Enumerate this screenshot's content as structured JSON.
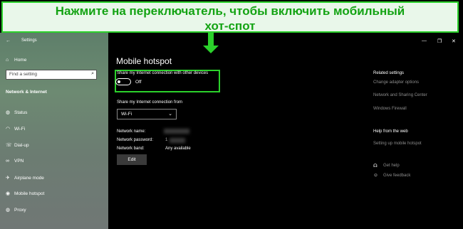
{
  "banner": {
    "line1": "Нажмите на переключатель, чтобы включить мобильный",
    "line2": "хот-спот"
  },
  "titlebar": {
    "back_icon": "back-arrow-icon",
    "title": "Settings"
  },
  "window_controls": {
    "minimize": "—",
    "maximize": "❐",
    "close": "✕"
  },
  "sidebar": {
    "home": "Home",
    "search_placeholder": "Find a setting",
    "section": "Network & Internet",
    "items": [
      {
        "label": "Status",
        "icon": "globe-icon"
      },
      {
        "label": "Wi-Fi",
        "icon": "wifi-icon"
      },
      {
        "label": "Dial-up",
        "icon": "phone-icon"
      },
      {
        "label": "VPN",
        "icon": "vpn-icon"
      },
      {
        "label": "Airplane mode",
        "icon": "airplane-icon"
      },
      {
        "label": "Mobile hotspot",
        "icon": "hotspot-icon"
      },
      {
        "label": "Proxy",
        "icon": "globe-icon"
      }
    ]
  },
  "main": {
    "title": "Mobile hotspot",
    "share_label": "Share my Internet connection with other devices",
    "toggle_state": "Off",
    "share_from_label": "Share my Internet connection from",
    "share_from_value": "Wi-Fi",
    "network_name_label": "Network name:",
    "network_password_label": "Network password:",
    "network_password_value": "1",
    "network_band_label": "Network band:",
    "network_band_value": "Any available",
    "edit_button": "Edit"
  },
  "related": {
    "heading": "Related settings",
    "links": [
      "Change adapter options",
      "Network and Sharing Center",
      "Windows Firewall"
    ],
    "help_heading": "Help from the web",
    "help_link": "Setting up mobile hotspot",
    "get_help": "Get help",
    "give_feedback": "Give feedback"
  }
}
